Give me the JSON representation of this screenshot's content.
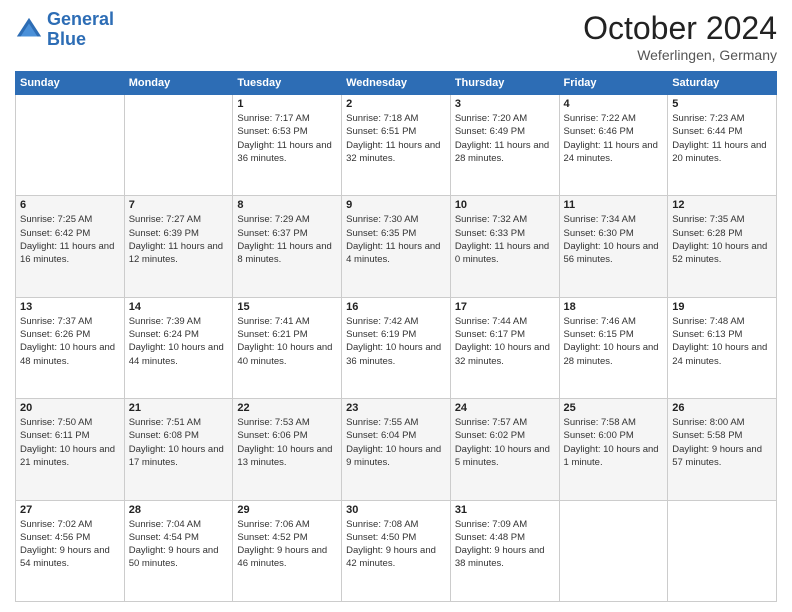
{
  "header": {
    "logo_line1": "General",
    "logo_line2": "Blue",
    "title": "October 2024",
    "subtitle": "Weferlingen, Germany"
  },
  "weekdays": [
    "Sunday",
    "Monday",
    "Tuesday",
    "Wednesday",
    "Thursday",
    "Friday",
    "Saturday"
  ],
  "weeks": [
    [
      {
        "day": "",
        "sunrise": "",
        "sunset": "",
        "daylight": ""
      },
      {
        "day": "",
        "sunrise": "",
        "sunset": "",
        "daylight": ""
      },
      {
        "day": "1",
        "sunrise": "Sunrise: 7:17 AM",
        "sunset": "Sunset: 6:53 PM",
        "daylight": "Daylight: 11 hours and 36 minutes."
      },
      {
        "day": "2",
        "sunrise": "Sunrise: 7:18 AM",
        "sunset": "Sunset: 6:51 PM",
        "daylight": "Daylight: 11 hours and 32 minutes."
      },
      {
        "day": "3",
        "sunrise": "Sunrise: 7:20 AM",
        "sunset": "Sunset: 6:49 PM",
        "daylight": "Daylight: 11 hours and 28 minutes."
      },
      {
        "day": "4",
        "sunrise": "Sunrise: 7:22 AM",
        "sunset": "Sunset: 6:46 PM",
        "daylight": "Daylight: 11 hours and 24 minutes."
      },
      {
        "day": "5",
        "sunrise": "Sunrise: 7:23 AM",
        "sunset": "Sunset: 6:44 PM",
        "daylight": "Daylight: 11 hours and 20 minutes."
      }
    ],
    [
      {
        "day": "6",
        "sunrise": "Sunrise: 7:25 AM",
        "sunset": "Sunset: 6:42 PM",
        "daylight": "Daylight: 11 hours and 16 minutes."
      },
      {
        "day": "7",
        "sunrise": "Sunrise: 7:27 AM",
        "sunset": "Sunset: 6:39 PM",
        "daylight": "Daylight: 11 hours and 12 minutes."
      },
      {
        "day": "8",
        "sunrise": "Sunrise: 7:29 AM",
        "sunset": "Sunset: 6:37 PM",
        "daylight": "Daylight: 11 hours and 8 minutes."
      },
      {
        "day": "9",
        "sunrise": "Sunrise: 7:30 AM",
        "sunset": "Sunset: 6:35 PM",
        "daylight": "Daylight: 11 hours and 4 minutes."
      },
      {
        "day": "10",
        "sunrise": "Sunrise: 7:32 AM",
        "sunset": "Sunset: 6:33 PM",
        "daylight": "Daylight: 11 hours and 0 minutes."
      },
      {
        "day": "11",
        "sunrise": "Sunrise: 7:34 AM",
        "sunset": "Sunset: 6:30 PM",
        "daylight": "Daylight: 10 hours and 56 minutes."
      },
      {
        "day": "12",
        "sunrise": "Sunrise: 7:35 AM",
        "sunset": "Sunset: 6:28 PM",
        "daylight": "Daylight: 10 hours and 52 minutes."
      }
    ],
    [
      {
        "day": "13",
        "sunrise": "Sunrise: 7:37 AM",
        "sunset": "Sunset: 6:26 PM",
        "daylight": "Daylight: 10 hours and 48 minutes."
      },
      {
        "day": "14",
        "sunrise": "Sunrise: 7:39 AM",
        "sunset": "Sunset: 6:24 PM",
        "daylight": "Daylight: 10 hours and 44 minutes."
      },
      {
        "day": "15",
        "sunrise": "Sunrise: 7:41 AM",
        "sunset": "Sunset: 6:21 PM",
        "daylight": "Daylight: 10 hours and 40 minutes."
      },
      {
        "day": "16",
        "sunrise": "Sunrise: 7:42 AM",
        "sunset": "Sunset: 6:19 PM",
        "daylight": "Daylight: 10 hours and 36 minutes."
      },
      {
        "day": "17",
        "sunrise": "Sunrise: 7:44 AM",
        "sunset": "Sunset: 6:17 PM",
        "daylight": "Daylight: 10 hours and 32 minutes."
      },
      {
        "day": "18",
        "sunrise": "Sunrise: 7:46 AM",
        "sunset": "Sunset: 6:15 PM",
        "daylight": "Daylight: 10 hours and 28 minutes."
      },
      {
        "day": "19",
        "sunrise": "Sunrise: 7:48 AM",
        "sunset": "Sunset: 6:13 PM",
        "daylight": "Daylight: 10 hours and 24 minutes."
      }
    ],
    [
      {
        "day": "20",
        "sunrise": "Sunrise: 7:50 AM",
        "sunset": "Sunset: 6:11 PM",
        "daylight": "Daylight: 10 hours and 21 minutes."
      },
      {
        "day": "21",
        "sunrise": "Sunrise: 7:51 AM",
        "sunset": "Sunset: 6:08 PM",
        "daylight": "Daylight: 10 hours and 17 minutes."
      },
      {
        "day": "22",
        "sunrise": "Sunrise: 7:53 AM",
        "sunset": "Sunset: 6:06 PM",
        "daylight": "Daylight: 10 hours and 13 minutes."
      },
      {
        "day": "23",
        "sunrise": "Sunrise: 7:55 AM",
        "sunset": "Sunset: 6:04 PM",
        "daylight": "Daylight: 10 hours and 9 minutes."
      },
      {
        "day": "24",
        "sunrise": "Sunrise: 7:57 AM",
        "sunset": "Sunset: 6:02 PM",
        "daylight": "Daylight: 10 hours and 5 minutes."
      },
      {
        "day": "25",
        "sunrise": "Sunrise: 7:58 AM",
        "sunset": "Sunset: 6:00 PM",
        "daylight": "Daylight: 10 hours and 1 minute."
      },
      {
        "day": "26",
        "sunrise": "Sunrise: 8:00 AM",
        "sunset": "Sunset: 5:58 PM",
        "daylight": "Daylight: 9 hours and 57 minutes."
      }
    ],
    [
      {
        "day": "27",
        "sunrise": "Sunrise: 7:02 AM",
        "sunset": "Sunset: 4:56 PM",
        "daylight": "Daylight: 9 hours and 54 minutes."
      },
      {
        "day": "28",
        "sunrise": "Sunrise: 7:04 AM",
        "sunset": "Sunset: 4:54 PM",
        "daylight": "Daylight: 9 hours and 50 minutes."
      },
      {
        "day": "29",
        "sunrise": "Sunrise: 7:06 AM",
        "sunset": "Sunset: 4:52 PM",
        "daylight": "Daylight: 9 hours and 46 minutes."
      },
      {
        "day": "30",
        "sunrise": "Sunrise: 7:08 AM",
        "sunset": "Sunset: 4:50 PM",
        "daylight": "Daylight: 9 hours and 42 minutes."
      },
      {
        "day": "31",
        "sunrise": "Sunrise: 7:09 AM",
        "sunset": "Sunset: 4:48 PM",
        "daylight": "Daylight: 9 hours and 38 minutes."
      },
      {
        "day": "",
        "sunrise": "",
        "sunset": "",
        "daylight": ""
      },
      {
        "day": "",
        "sunrise": "",
        "sunset": "",
        "daylight": ""
      }
    ]
  ]
}
